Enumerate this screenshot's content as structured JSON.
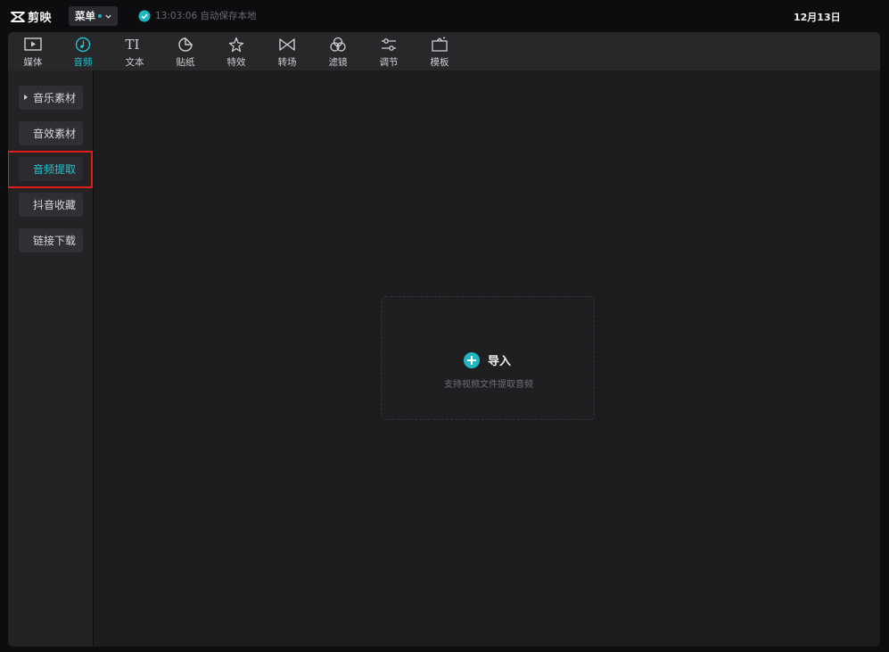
{
  "app": {
    "name": "剪映",
    "menu_label": "菜单",
    "autosave_text": "13:03:06 自动保存本地",
    "date": "12月13日"
  },
  "toolbar": {
    "tools": [
      {
        "label": "媒体",
        "icon": "media-icon"
      },
      {
        "label": "音频",
        "icon": "audio-icon",
        "active": true
      },
      {
        "label": "文本",
        "icon": "text-icon"
      },
      {
        "label": "贴纸",
        "icon": "sticker-icon"
      },
      {
        "label": "特效",
        "icon": "effects-icon"
      },
      {
        "label": "转场",
        "icon": "transition-icon"
      },
      {
        "label": "滤镜",
        "icon": "filter-icon"
      },
      {
        "label": "调节",
        "icon": "adjust-icon"
      },
      {
        "label": "模板",
        "icon": "template-icon"
      }
    ]
  },
  "sidebar": {
    "items": [
      {
        "label": "音乐素材",
        "expandable": true
      },
      {
        "label": "音效素材"
      },
      {
        "label": "音频提取",
        "active": true,
        "highlighted": true
      },
      {
        "label": "抖音收藏"
      },
      {
        "label": "链接下载"
      }
    ]
  },
  "import": {
    "label": "导入",
    "subtitle": "支持视频文件提取音频"
  },
  "colors": {
    "accent": "#1fb6c4",
    "highlight_border": "#e11b1b",
    "background": "#1c1c1e"
  }
}
